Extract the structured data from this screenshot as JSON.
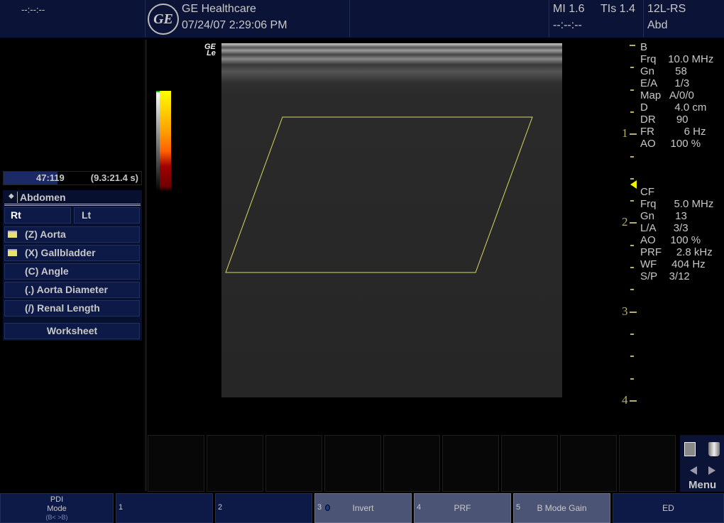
{
  "header": {
    "left_time": "--:--:--",
    "brand": "GE Healthcare",
    "datetime": "07/24/07 2:29:06 PM",
    "mi": "MI 1.6",
    "tis": "TIs 1.4",
    "time2": "--:--:--",
    "probe": "12L-RS",
    "preset": "Abd",
    "logo_text": "GE"
  },
  "image": {
    "watermark_top": "GE",
    "watermark_bottom": "Le"
  },
  "cine": {
    "frame": "47:119",
    "time_range": "(9.3:21.4 s)"
  },
  "measure": {
    "category": "Abdomen",
    "side_buttons": [
      "Rt",
      "Lt"
    ],
    "items": [
      {
        "label": "(Z)  Aorta",
        "folder": true
      },
      {
        "label": "(X)  Gallbladder",
        "folder": true
      },
      {
        "label": "(C)  Angle",
        "folder": false
      },
      {
        "label": "(.)  Aorta Diameter",
        "folder": false
      },
      {
        "label": "(/)  Renal Length",
        "folder": false
      }
    ],
    "worksheet": "Worksheet"
  },
  "bmode": {
    "title": "B",
    "rows": [
      "Frq    10.0 MHz",
      "Gn       58",
      "E/A      1/3",
      "Map   A/0/0",
      "D         4.0 cm",
      "DR       90",
      "FR          6 Hz",
      "AO     100 %"
    ]
  },
  "cf": {
    "title": "CF",
    "rows": [
      "Frq      5.0 MHz",
      "Gn       13",
      "L/A      3/3",
      "AO     100 %",
      "PRF     2.8 kHz",
      "WF     404 Hz",
      "S/P    3/12"
    ]
  },
  "depth_scale": {
    "labels": [
      "1",
      "2",
      "3",
      "4"
    ],
    "unit": "cm",
    "color": "#b8b066"
  },
  "side_tools": {
    "icons": [
      "worksheet-grid-icon",
      "trash-icon",
      "arrow-left-icon",
      "arrow-right-icon"
    ],
    "menu": "Menu"
  },
  "softkeys": [
    {
      "num": "",
      "label": "PDI\nMode",
      "sub": "(B< >B)"
    },
    {
      "num": "1",
      "label": ""
    },
    {
      "num": "2",
      "label": ""
    },
    {
      "num": "3",
      "label": "Invert",
      "active": true
    },
    {
      "num": "4",
      "label": "PRF",
      "active": true
    },
    {
      "num": "5",
      "label": "B Mode Gain",
      "active": true
    },
    {
      "num": "",
      "label": "ED"
    }
  ],
  "colors": {
    "header_bg": "#0b1437",
    "button_bg": "#0d1a47",
    "button_active": "#4b5475",
    "roi_line": "#d8d860"
  }
}
